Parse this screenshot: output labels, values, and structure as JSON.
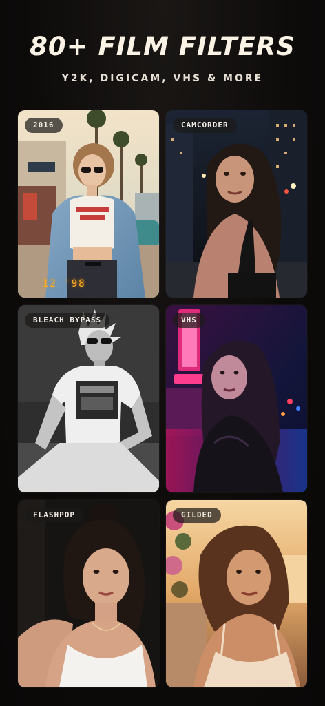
{
  "header": {
    "title": "80+ FILM FILTERS",
    "subtitle": "Y2K, DIGICAM, VHS & MORE"
  },
  "filters": [
    {
      "label": "2016",
      "stamp": "12 '98",
      "photo": "young woman in sunglasses and red crop top on sunny street"
    },
    {
      "label": "CAMCORDER",
      "photo": "woman at night on city street with lights"
    },
    {
      "label": "BLEACH BYPASS",
      "photo": "man in sunglasses and graphic tee sitting, desaturated"
    },
    {
      "label": "VHS",
      "photo": "woman in leather jacket under neon motel sign in rain"
    },
    {
      "label": "FLASHPOP",
      "photo": "woman in white camisole lit by flash against dark wall"
    },
    {
      "label": "GILDED",
      "photo": "woman in golden sunset light by the sea"
    }
  ],
  "colors": {
    "background": "#0d0b0a",
    "title": "#fbf3e6",
    "badge_bg": "#1c1a19",
    "date_stamp": "#ffb01f"
  }
}
